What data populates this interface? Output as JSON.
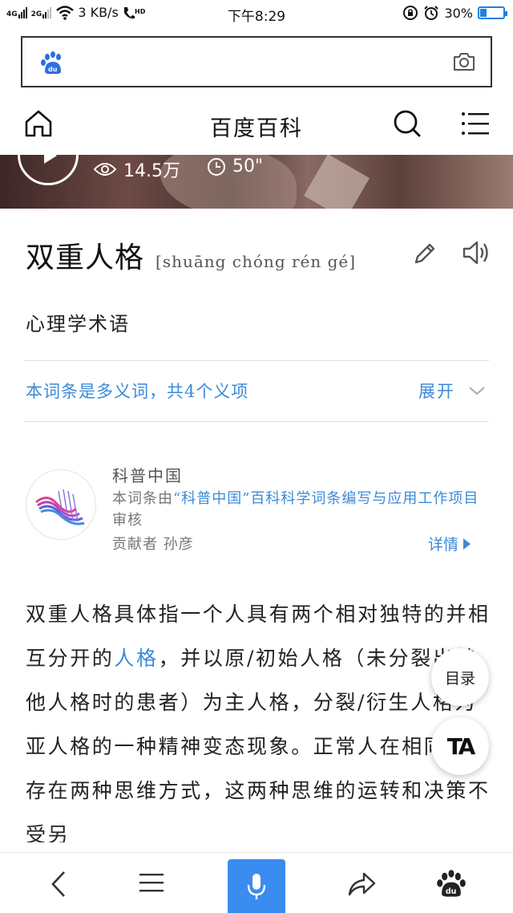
{
  "status_bar": {
    "network_1": "4G",
    "network_2": "2G",
    "speed": "3 KB/s",
    "hd": "HD",
    "time": "下午8:29",
    "battery": "30%",
    "battery_level": 0.3
  },
  "header": {
    "title": "百度百科"
  },
  "video": {
    "views": "14.5万",
    "duration": "50\""
  },
  "entry": {
    "title": "双重人格",
    "pinyin": "[shuāng chóng rén gé]",
    "subtitle": "心理学术语",
    "polysemy_note": "本词条是多义词，共4个义项",
    "expand_label": "展开"
  },
  "contributor": {
    "org_name": "科普中国",
    "review_prefix": "本词条由",
    "review_highlight": "“科普中国”百科科学词条编写与应用工作项目",
    "review_suffix": "审核",
    "contributor_label": "贡献者",
    "contributor_name": "孙彦",
    "details_label": "详情"
  },
  "article": {
    "part1": "双重人格具体指一个人具有两个相对独特的并相互分开的",
    "link": "人格",
    "part2": "，并以原/初始人格（未分裂出其他人格时的患者）为主人格，分裂/衍生人格为亚人格的一种精神变态现象。正常人在相同时刻存在两种思维方式，这两种思维的运转和决策不受另"
  },
  "floating": {
    "toc_label": "目录",
    "ta_label": "TA"
  },
  "icons": {
    "paw": "baidu-paw-icon",
    "camera": "camera-icon",
    "home": "home-icon",
    "search": "search-icon",
    "menu": "menu-icon",
    "edit": "pencil-icon",
    "speaker": "speaker-icon",
    "back": "chevron-left-icon",
    "share": "share-icon",
    "mic": "microphone-icon"
  },
  "colors": {
    "accent_blue": "#3c8ad8",
    "mic_blue": "#3b8cf0",
    "battery_blue": "#1f7fe0"
  }
}
